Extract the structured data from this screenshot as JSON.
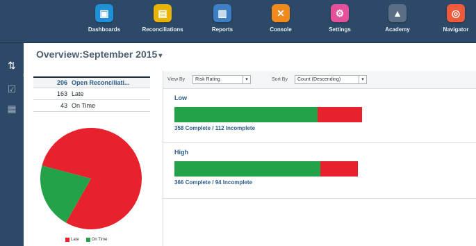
{
  "nav": {
    "items": [
      {
        "label": "Dashboards",
        "icon": "dashboard-icon",
        "color": "#1f8fd6",
        "glyph": "▣"
      },
      {
        "label": "Reconciliations",
        "icon": "reconciliations-icon",
        "color": "#e8b400",
        "glyph": "▤"
      },
      {
        "label": "Reports",
        "icon": "reports-icon",
        "color": "#3d7fc4",
        "glyph": "▥"
      },
      {
        "label": "Console",
        "icon": "console-icon",
        "color": "#f08a1c",
        "glyph": "✕"
      },
      {
        "label": "Settings",
        "icon": "settings-icon",
        "color": "#e4509a",
        "glyph": "⚙"
      },
      {
        "label": "Academy",
        "icon": "academy-icon",
        "color": "#5a6f86",
        "glyph": "▲"
      },
      {
        "label": "Navigator",
        "icon": "navigator-icon",
        "color": "#ef5a3c",
        "glyph": "◎"
      }
    ]
  },
  "overview": {
    "title": "Overview:September 2015",
    "caret": "▾"
  },
  "counts": [
    {
      "num": "206",
      "label": "Open Reconciliati..."
    },
    {
      "num": "163",
      "label": "Late"
    },
    {
      "num": "43",
      "label": "On Time"
    }
  ],
  "chart_data": {
    "type": "pie",
    "slices": [
      {
        "label": "Late",
        "value": 163,
        "color": "#e8222c"
      },
      {
        "label": "On Time",
        "value": 43,
        "color": "#24a24a"
      }
    ],
    "legend_position": "bottom"
  },
  "toolbar": {
    "view_by_label": "View By",
    "view_by_value": "Risk Rating",
    "sort_by_label": "Sort By",
    "sort_by_value": "Count (Descending)",
    "dropdown_glyph": "▾"
  },
  "bars": [
    {
      "title": "Low",
      "complete": 358,
      "incomplete": 112,
      "caption": "358 Complete / 112 Incomplete"
    },
    {
      "title": "High",
      "complete": 366,
      "incomplete": 94,
      "caption": "366 Complete / 94 Incomplete"
    }
  ],
  "colors": {
    "complete": "#24a24a",
    "incomplete": "#e8222c",
    "nav_bg": "#2c4a68",
    "link": "#2b5a8c"
  }
}
